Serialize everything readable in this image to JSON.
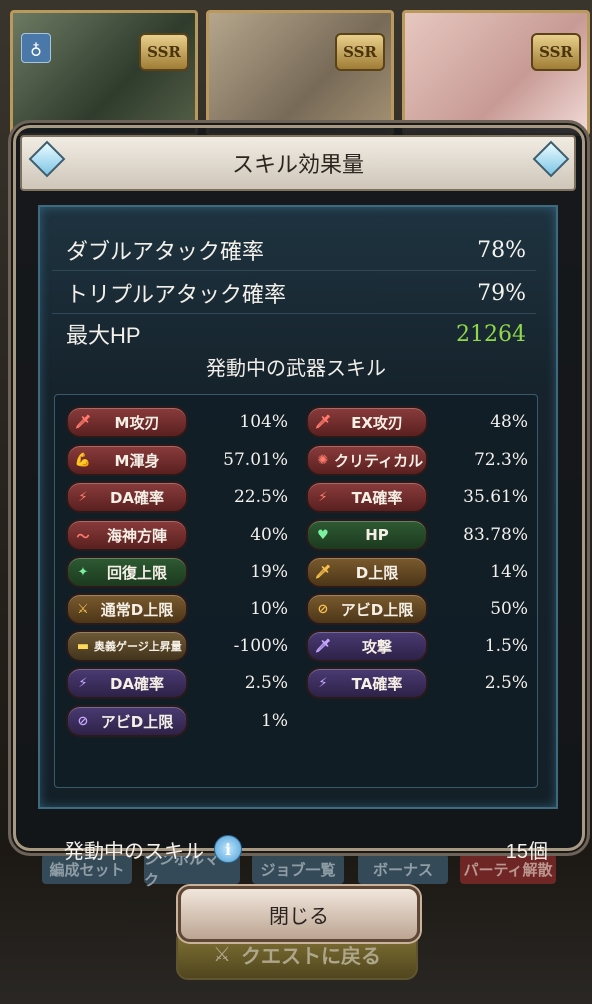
{
  "background": {
    "cards": [
      {
        "badge": "SSR"
      },
      {
        "badge": "SSR"
      },
      {
        "badge": "SSR"
      }
    ],
    "buttons": [
      "編成セット",
      "シンボルマーク",
      "ジョブ一覧",
      "ボーナス",
      "パーティ解散"
    ],
    "quest_button": "クエストに戻る"
  },
  "dialog": {
    "title": "スキル効果量",
    "stats": [
      {
        "label": "ダブルアタック確率",
        "value": "78%"
      },
      {
        "label": "トリプルアタック確率",
        "value": "79%"
      },
      {
        "label": "最大HP",
        "value": "21264"
      }
    ],
    "section_title": "発動中の武器スキル",
    "skills": [
      {
        "label": "M攻刃",
        "value": "104%",
        "color": "red",
        "icon": "sword-icon"
      },
      {
        "label": "EX攻刃",
        "value": "48%",
        "color": "red",
        "icon": "sword-icon"
      },
      {
        "label": "M渾身",
        "value": "57.01%",
        "color": "red",
        "icon": "muscle-icon"
      },
      {
        "label": "クリティカル",
        "value": "72.3%",
        "color": "red",
        "icon": "burst-icon"
      },
      {
        "label": "DA確率",
        "value": "22.5%",
        "color": "red",
        "icon": "double-slash-icon"
      },
      {
        "label": "TA確率",
        "value": "35.61%",
        "color": "red",
        "icon": "triple-slash-icon"
      },
      {
        "label": "海神方陣",
        "value": "40%",
        "color": "red",
        "icon": "wave-icon"
      },
      {
        "label": "HP",
        "value": "83.78%",
        "color": "green",
        "icon": "heart-icon"
      },
      {
        "label": "回復上限",
        "value": "19%",
        "color": "green",
        "icon": "sparkle-icon"
      },
      {
        "label": "D上限",
        "value": "14%",
        "color": "orange",
        "icon": "sword-icon"
      },
      {
        "label": "通常D上限",
        "value": "10%",
        "color": "orange",
        "icon": "cross-swords-icon"
      },
      {
        "label": "アビD上限",
        "value": "50%",
        "color": "orange",
        "icon": "striped-circle-icon"
      },
      {
        "label": "奥義ゲージ上昇量",
        "value": "-100%",
        "color": "yellowbar",
        "icon": "gauge-icon"
      },
      {
        "label": "攻撃",
        "value": "1.5%",
        "color": "purple",
        "icon": "sword-icon"
      },
      {
        "label": "DA確率",
        "value": "2.5%",
        "color": "purple",
        "icon": "double-slash-icon"
      },
      {
        "label": "TA確率",
        "value": "2.5%",
        "color": "purple",
        "icon": "triple-slash-icon"
      },
      {
        "label": "アビD上限",
        "value": "1%",
        "color": "purple",
        "icon": "striped-circle-icon"
      }
    ],
    "footer": {
      "label": "発動中のスキル",
      "count": "15個"
    },
    "close_button": "閉じる"
  }
}
